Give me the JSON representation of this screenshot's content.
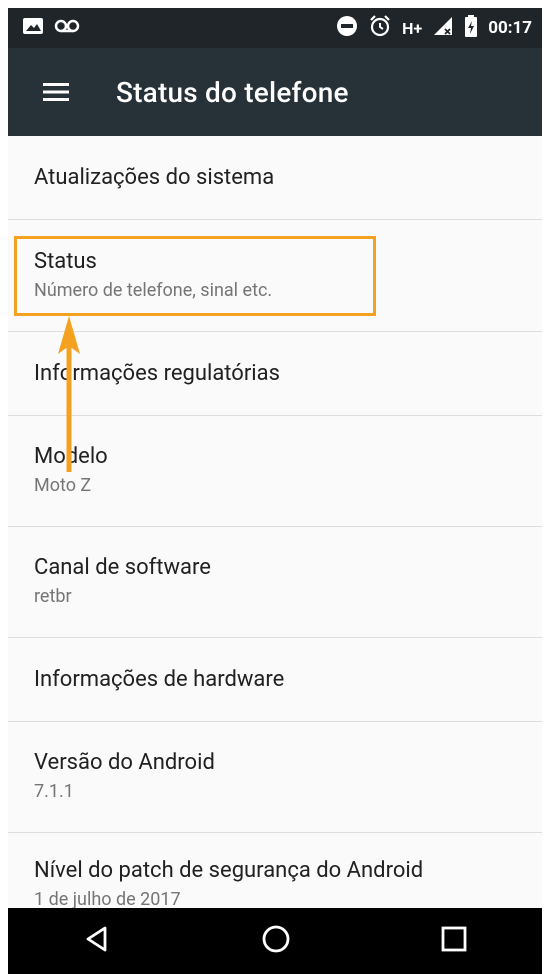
{
  "status_bar": {
    "time": "00:17",
    "network": "H+",
    "icons": [
      "image-icon",
      "voicemail-icon",
      "do-not-disturb-icon",
      "alarm-icon",
      "signal-icon",
      "battery-icon"
    ]
  },
  "app_bar": {
    "title": "Status do telefone",
    "menu_icon": "hamburger-menu-icon"
  },
  "items": [
    {
      "title": "Atualizações do sistema",
      "subtitle": ""
    },
    {
      "title": "Status",
      "subtitle": "Número de telefone, sinal etc."
    },
    {
      "title": "Informações regulatórias",
      "subtitle": ""
    },
    {
      "title": "Modelo",
      "subtitle": "Moto Z"
    },
    {
      "title": "Canal de software",
      "subtitle": "retbr"
    },
    {
      "title": "Informações de hardware",
      "subtitle": ""
    },
    {
      "title": "Versão do Android",
      "subtitle": "7.1.1"
    },
    {
      "title": "Nível do patch de segurança do Android",
      "subtitle": "1 de julho de 2017"
    }
  ],
  "nav_bar": {
    "icons": [
      "back-icon",
      "home-icon",
      "recents-icon"
    ]
  },
  "colors": {
    "appbar": "#263238",
    "statusbar": "#1f2528",
    "highlight": "#f4a11f",
    "background": "#fafafa"
  }
}
